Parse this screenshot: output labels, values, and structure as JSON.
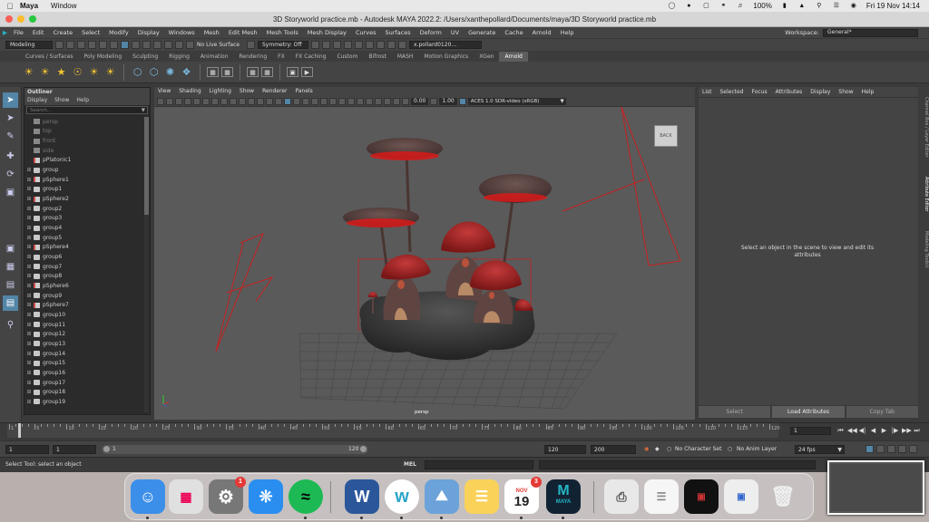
{
  "mac_menubar": {
    "app": "Maya",
    "menus": [
      "Window"
    ],
    "battery": "100%",
    "clock": "Fri 19 Nov  14:14"
  },
  "window": {
    "title": "3D Storyworld practice.mb - Autodesk MAYA 2022.2: /Users/xanthepollard/Documents/maya/3D Storyworld practice.mb"
  },
  "maya_menu": {
    "items": [
      "File",
      "Edit",
      "Create",
      "Select",
      "Modify",
      "Display",
      "Windows",
      "Mesh",
      "Edit Mesh",
      "Mesh Tools",
      "Mesh Display",
      "Curves",
      "Surfaces",
      "Deform",
      "UV",
      "Generate",
      "Cache",
      "Arnold",
      "Help"
    ],
    "workspace_label": "Workspace:",
    "workspace_value": "General*"
  },
  "statusline": {
    "mode": "Modeling",
    "live_surface": "No Live Surface",
    "symmetry": "Symmetry: Off",
    "user": "x.pollard0120..."
  },
  "shelf": {
    "tabs": [
      "Curves / Surfaces",
      "Poly Modeling",
      "Sculpting",
      "Rigging",
      "Animation",
      "Rendering",
      "FX",
      "FX Caching",
      "Custom",
      "Bifrost",
      "MASH",
      "Motion Graphics",
      "XGen",
      "Arnold"
    ],
    "active_tab": "Arnold"
  },
  "outliner": {
    "title": "Outliner",
    "menus": [
      "Display",
      "Show",
      "Help"
    ],
    "search_placeholder": "Search...",
    "items": [
      {
        "label": "persp",
        "type": "cam",
        "dim": true
      },
      {
        "label": "top",
        "type": "cam",
        "dim": true
      },
      {
        "label": "front",
        "type": "cam",
        "dim": true
      },
      {
        "label": "side",
        "type": "cam",
        "dim": true
      },
      {
        "label": "pPlatonic1",
        "type": "mesh",
        "dim": false
      },
      {
        "label": "group",
        "type": "grp",
        "dim": false
      },
      {
        "label": "pSphere1",
        "type": "mesh",
        "dim": false
      },
      {
        "label": "group1",
        "type": "grp",
        "dim": false
      },
      {
        "label": "pSphere2",
        "type": "mesh",
        "dim": false
      },
      {
        "label": "group2",
        "type": "grp",
        "dim": false
      },
      {
        "label": "group3",
        "type": "grp",
        "dim": false
      },
      {
        "label": "group4",
        "type": "grp",
        "dim": false
      },
      {
        "label": "group5",
        "type": "grp",
        "dim": false
      },
      {
        "label": "pSphere4",
        "type": "mesh",
        "dim": false
      },
      {
        "label": "group6",
        "type": "grp",
        "dim": false
      },
      {
        "label": "group7",
        "type": "grp",
        "dim": false
      },
      {
        "label": "group8",
        "type": "grp",
        "dim": false
      },
      {
        "label": "pSphere6",
        "type": "mesh",
        "dim": false
      },
      {
        "label": "group9",
        "type": "grp",
        "dim": false
      },
      {
        "label": "pSphere7",
        "type": "mesh",
        "dim": false
      },
      {
        "label": "group10",
        "type": "grp",
        "dim": false
      },
      {
        "label": "group11",
        "type": "grp",
        "dim": false
      },
      {
        "label": "group12",
        "type": "grp",
        "dim": false
      },
      {
        "label": "group13",
        "type": "grp",
        "dim": false
      },
      {
        "label": "group14",
        "type": "grp",
        "dim": false
      },
      {
        "label": "group15",
        "type": "grp",
        "dim": false
      },
      {
        "label": "group16",
        "type": "grp",
        "dim": false
      },
      {
        "label": "group17",
        "type": "grp",
        "dim": false
      },
      {
        "label": "group18",
        "type": "grp",
        "dim": false
      },
      {
        "label": "group19",
        "type": "grp",
        "dim": false
      }
    ]
  },
  "viewport": {
    "menus": [
      "View",
      "Shading",
      "Lighting",
      "Show",
      "Renderer",
      "Panels"
    ],
    "exposure": "0.00",
    "gamma": "1.00",
    "color_space": "ACES 1.0 SDR-video (sRGB)",
    "camera_label": "persp",
    "viewcube_face": "BACK"
  },
  "attribute_editor": {
    "menus": [
      "List",
      "Selected",
      "Focus",
      "Attributes",
      "Display",
      "Show",
      "Help"
    ],
    "message": "Select an object in the scene to view and edit its attributes",
    "buttons": [
      "Select",
      "Load Attributes",
      "Copy Tab"
    ],
    "side_tabs": [
      "Channel Box / Layer Editor",
      "Attribute Editor",
      "Modeling Toolkit"
    ]
  },
  "timeline": {
    "tick_labels": [
      "1",
      "5",
      "10",
      "15",
      "20",
      "25",
      "30",
      "35",
      "40",
      "45",
      "50",
      "55",
      "60",
      "65",
      "70",
      "75",
      "80",
      "85",
      "90",
      "95",
      "100",
      "105",
      "110",
      "115",
      "120"
    ],
    "current_frame": "1"
  },
  "range": {
    "start": "1",
    "playback_start": "1",
    "range_start_label": "1",
    "range_end_label": "120",
    "playback_end": "120",
    "end": "200",
    "character_set": "No Character Set",
    "anim_layer": "No Anim Layer",
    "fps": "24 fps"
  },
  "cmdline": {
    "help": "Select Tool: select an object",
    "mel_label": "MEL"
  },
  "dock": {
    "calendar_month": "NOV",
    "calendar_day": "19",
    "calendar_badge": "3",
    "settings_badge": "1",
    "maya_label": "MAYA"
  }
}
